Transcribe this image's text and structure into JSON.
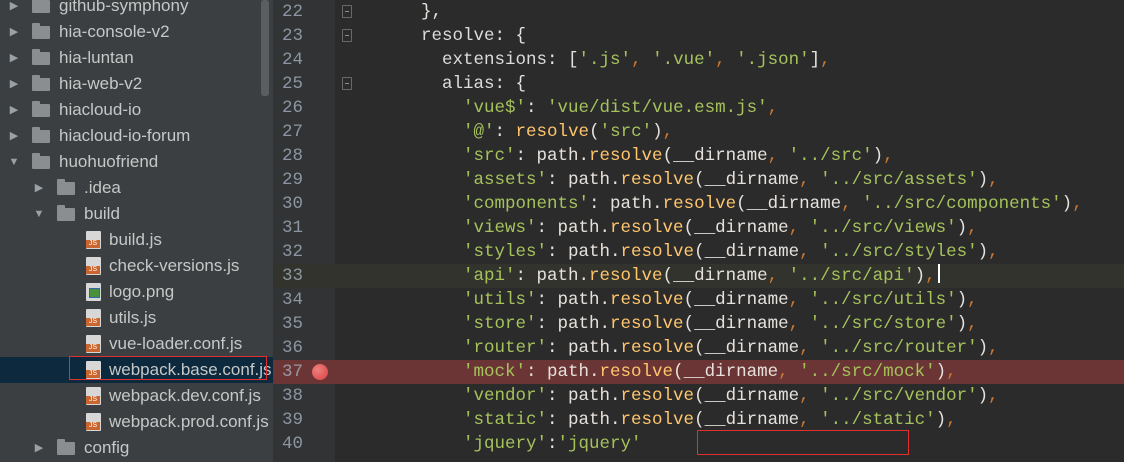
{
  "tree": {
    "items": [
      {
        "label": "github-symphony",
        "type": "folder",
        "expanded": false,
        "depth": 0
      },
      {
        "label": "hia-console-v2",
        "type": "folder",
        "expanded": false,
        "depth": 0
      },
      {
        "label": "hia-luntan",
        "type": "folder",
        "expanded": false,
        "depth": 0
      },
      {
        "label": "hia-web-v2",
        "type": "folder",
        "expanded": false,
        "depth": 0
      },
      {
        "label": "hiacloud-io",
        "type": "folder",
        "expanded": false,
        "depth": 0
      },
      {
        "label": "hiacloud-io-forum",
        "type": "folder",
        "expanded": false,
        "depth": 0
      },
      {
        "label": "huohuofriend",
        "type": "folder",
        "expanded": true,
        "depth": 0
      },
      {
        "label": ".idea",
        "type": "folder",
        "expanded": false,
        "depth": 1
      },
      {
        "label": "build",
        "type": "folder",
        "expanded": true,
        "depth": 1
      },
      {
        "label": "build.js",
        "type": "js",
        "depth": 2
      },
      {
        "label": "check-versions.js",
        "type": "js",
        "depth": 2
      },
      {
        "label": "logo.png",
        "type": "image",
        "depth": 2
      },
      {
        "label": "utils.js",
        "type": "js",
        "depth": 2
      },
      {
        "label": "vue-loader.conf.js",
        "type": "js",
        "depth": 2
      },
      {
        "label": "webpack.base.conf.js",
        "type": "js",
        "depth": 2,
        "selected": true
      },
      {
        "label": "webpack.dev.conf.js",
        "type": "js",
        "depth": 2
      },
      {
        "label": "webpack.prod.conf.js",
        "type": "js",
        "depth": 2
      },
      {
        "label": "config",
        "type": "folder",
        "expanded": false,
        "depth": 1
      }
    ],
    "js_badge": "JS"
  },
  "editor": {
    "lines": [
      {
        "no": "22",
        "fold": true,
        "tokens": [
          {
            "t": "    },",
            "c": "plain"
          }
        ]
      },
      {
        "no": "23",
        "fold": true,
        "tokens": [
          {
            "t": "    resolve",
            "c": "key"
          },
          {
            "t": ": {",
            "c": "plain"
          }
        ]
      },
      {
        "no": "24",
        "tokens": [
          {
            "t": "      extensions",
            "c": "key"
          },
          {
            "t": ": [",
            "c": "plain"
          },
          {
            "t": "'.js'",
            "c": "str"
          },
          {
            "t": ", ",
            "c": "punct"
          },
          {
            "t": "'.vue'",
            "c": "str"
          },
          {
            "t": ", ",
            "c": "punct"
          },
          {
            "t": "'.json'",
            "c": "str"
          },
          {
            "t": "]",
            "c": "plain"
          },
          {
            "t": ",",
            "c": "punct"
          }
        ]
      },
      {
        "no": "25",
        "fold": true,
        "tokens": [
          {
            "t": "      alias",
            "c": "key"
          },
          {
            "t": ": {",
            "c": "plain"
          }
        ]
      },
      {
        "no": "26",
        "tokens": [
          {
            "t": "        'vue$'",
            "c": "str"
          },
          {
            "t": ": ",
            "c": "plain"
          },
          {
            "t": "'vue/dist/vue.esm.js'",
            "c": "str"
          },
          {
            "t": ",",
            "c": "punct"
          }
        ]
      },
      {
        "no": "27",
        "tokens": [
          {
            "t": "        '@'",
            "c": "str"
          },
          {
            "t": ": ",
            "c": "plain"
          },
          {
            "t": "resolve",
            "c": "func"
          },
          {
            "t": "(",
            "c": "plain"
          },
          {
            "t": "'src'",
            "c": "str"
          },
          {
            "t": ")",
            "c": "plain"
          },
          {
            "t": ",",
            "c": "punct"
          }
        ]
      },
      {
        "no": "28",
        "tokens": [
          {
            "t": "        'src'",
            "c": "str"
          },
          {
            "t": ": path.",
            "c": "plain"
          },
          {
            "t": "resolve",
            "c": "func"
          },
          {
            "t": "(__dirname",
            "c": "plain"
          },
          {
            "t": ", ",
            "c": "punct"
          },
          {
            "t": "'../src'",
            "c": "str"
          },
          {
            "t": ")",
            "c": "plain"
          },
          {
            "t": ",",
            "c": "punct"
          }
        ]
      },
      {
        "no": "29",
        "tokens": [
          {
            "t": "        'assets'",
            "c": "str"
          },
          {
            "t": ": path.",
            "c": "plain"
          },
          {
            "t": "resolve",
            "c": "func"
          },
          {
            "t": "(__dirname",
            "c": "plain"
          },
          {
            "t": ", ",
            "c": "punct"
          },
          {
            "t": "'../src/assets'",
            "c": "str"
          },
          {
            "t": ")",
            "c": "plain"
          },
          {
            "t": ",",
            "c": "punct"
          }
        ]
      },
      {
        "no": "30",
        "tokens": [
          {
            "t": "        'components'",
            "c": "str"
          },
          {
            "t": ": path.",
            "c": "plain"
          },
          {
            "t": "resolve",
            "c": "func"
          },
          {
            "t": "(__dirname",
            "c": "plain"
          },
          {
            "t": ", ",
            "c": "punct"
          },
          {
            "t": "'../src/components'",
            "c": "str"
          },
          {
            "t": ")",
            "c": "plain"
          },
          {
            "t": ",",
            "c": "punct"
          }
        ]
      },
      {
        "no": "31",
        "tokens": [
          {
            "t": "        'views'",
            "c": "str"
          },
          {
            "t": ": path.",
            "c": "plain"
          },
          {
            "t": "resolve",
            "c": "func"
          },
          {
            "t": "(__dirname",
            "c": "plain"
          },
          {
            "t": ", ",
            "c": "punct"
          },
          {
            "t": "'../src/views'",
            "c": "str"
          },
          {
            "t": ")",
            "c": "plain"
          },
          {
            "t": ",",
            "c": "punct"
          }
        ]
      },
      {
        "no": "32",
        "tokens": [
          {
            "t": "        'styles'",
            "c": "str"
          },
          {
            "t": ": path.",
            "c": "plain"
          },
          {
            "t": "resolve",
            "c": "func"
          },
          {
            "t": "(__dirname",
            "c": "plain"
          },
          {
            "t": ", ",
            "c": "punct"
          },
          {
            "t": "'../src/styles'",
            "c": "str"
          },
          {
            "t": ")",
            "c": "plain"
          },
          {
            "t": ",",
            "c": "punct"
          }
        ]
      },
      {
        "no": "33",
        "current": true,
        "caret": true,
        "tokens": [
          {
            "t": "        'api'",
            "c": "str"
          },
          {
            "t": ": path.",
            "c": "plain"
          },
          {
            "t": "resolve",
            "c": "func"
          },
          {
            "t": "(__dirname",
            "c": "plain"
          },
          {
            "t": ", ",
            "c": "punct"
          },
          {
            "t": "'../src/api'",
            "c": "str"
          },
          {
            "t": ")",
            "c": "plain"
          },
          {
            "t": ",",
            "c": "punct"
          }
        ]
      },
      {
        "no": "34",
        "tokens": [
          {
            "t": "        'utils'",
            "c": "str"
          },
          {
            "t": ": path.",
            "c": "plain"
          },
          {
            "t": "resolve",
            "c": "func"
          },
          {
            "t": "(__dirname",
            "c": "plain"
          },
          {
            "t": ", ",
            "c": "punct"
          },
          {
            "t": "'../src/utils'",
            "c": "str"
          },
          {
            "t": ")",
            "c": "plain"
          },
          {
            "t": ",",
            "c": "punct"
          }
        ]
      },
      {
        "no": "35",
        "tokens": [
          {
            "t": "        'store'",
            "c": "str"
          },
          {
            "t": ": path.",
            "c": "plain"
          },
          {
            "t": "resolve",
            "c": "func"
          },
          {
            "t": "(__dirname",
            "c": "plain"
          },
          {
            "t": ", ",
            "c": "punct"
          },
          {
            "t": "'../src/store'",
            "c": "str"
          },
          {
            "t": ")",
            "c": "plain"
          },
          {
            "t": ",",
            "c": "punct"
          }
        ]
      },
      {
        "no": "36",
        "tokens": [
          {
            "t": "        'router'",
            "c": "str"
          },
          {
            "t": ": path.",
            "c": "plain"
          },
          {
            "t": "resolve",
            "c": "func"
          },
          {
            "t": "(__dirname",
            "c": "plain"
          },
          {
            "t": ", ",
            "c": "punct"
          },
          {
            "t": "'../src/router'",
            "c": "str"
          },
          {
            "t": ")",
            "c": "plain"
          },
          {
            "t": ",",
            "c": "punct"
          }
        ]
      },
      {
        "no": "37",
        "breakpoint": true,
        "tokens": [
          {
            "t": "        'mock'",
            "c": "str"
          },
          {
            "t": ": path.",
            "c": "plain"
          },
          {
            "t": "resolve",
            "c": "func"
          },
          {
            "t": "(__dirname",
            "c": "plain"
          },
          {
            "t": ", ",
            "c": "punct"
          },
          {
            "t": "'../src/mock'",
            "c": "str"
          },
          {
            "t": ")",
            "c": "plain"
          },
          {
            "t": ",",
            "c": "punct"
          }
        ]
      },
      {
        "no": "38",
        "tokens": [
          {
            "t": "        'vendor'",
            "c": "str"
          },
          {
            "t": ": path.",
            "c": "plain"
          },
          {
            "t": "resolve",
            "c": "func"
          },
          {
            "t": "(__dirname",
            "c": "plain"
          },
          {
            "t": ", ",
            "c": "punct"
          },
          {
            "t": "'../src/vendor'",
            "c": "str"
          },
          {
            "t": ")",
            "c": "plain"
          },
          {
            "t": ",",
            "c": "punct"
          }
        ]
      },
      {
        "no": "39",
        "tokens": [
          {
            "t": "        'static'",
            "c": "str"
          },
          {
            "t": ": path.",
            "c": "plain"
          },
          {
            "t": "resolve",
            "c": "func"
          },
          {
            "t": "(__dirname",
            "c": "plain"
          },
          {
            "t": ", ",
            "c": "punct"
          },
          {
            "t": "'../static'",
            "c": "str"
          },
          {
            "t": ")",
            "c": "plain"
          },
          {
            "t": ",",
            "c": "punct"
          }
        ]
      },
      {
        "no": "40",
        "tokens": [
          {
            "t": "        'jquery'",
            "c": "str"
          },
          {
            "t": ":",
            "c": "plain"
          },
          {
            "t": "'jquery'",
            "c": "str"
          }
        ]
      }
    ]
  },
  "colors": {
    "tree_bg": "#3c3f41",
    "editor_bg": "#2b2b2b",
    "selection": "#0d293e",
    "breakpoint_line": "#6b3535",
    "highlight_box": "#e03030",
    "string": "#a5c25c",
    "function": "#ffc66d",
    "punctuation": "#cc7832"
  }
}
